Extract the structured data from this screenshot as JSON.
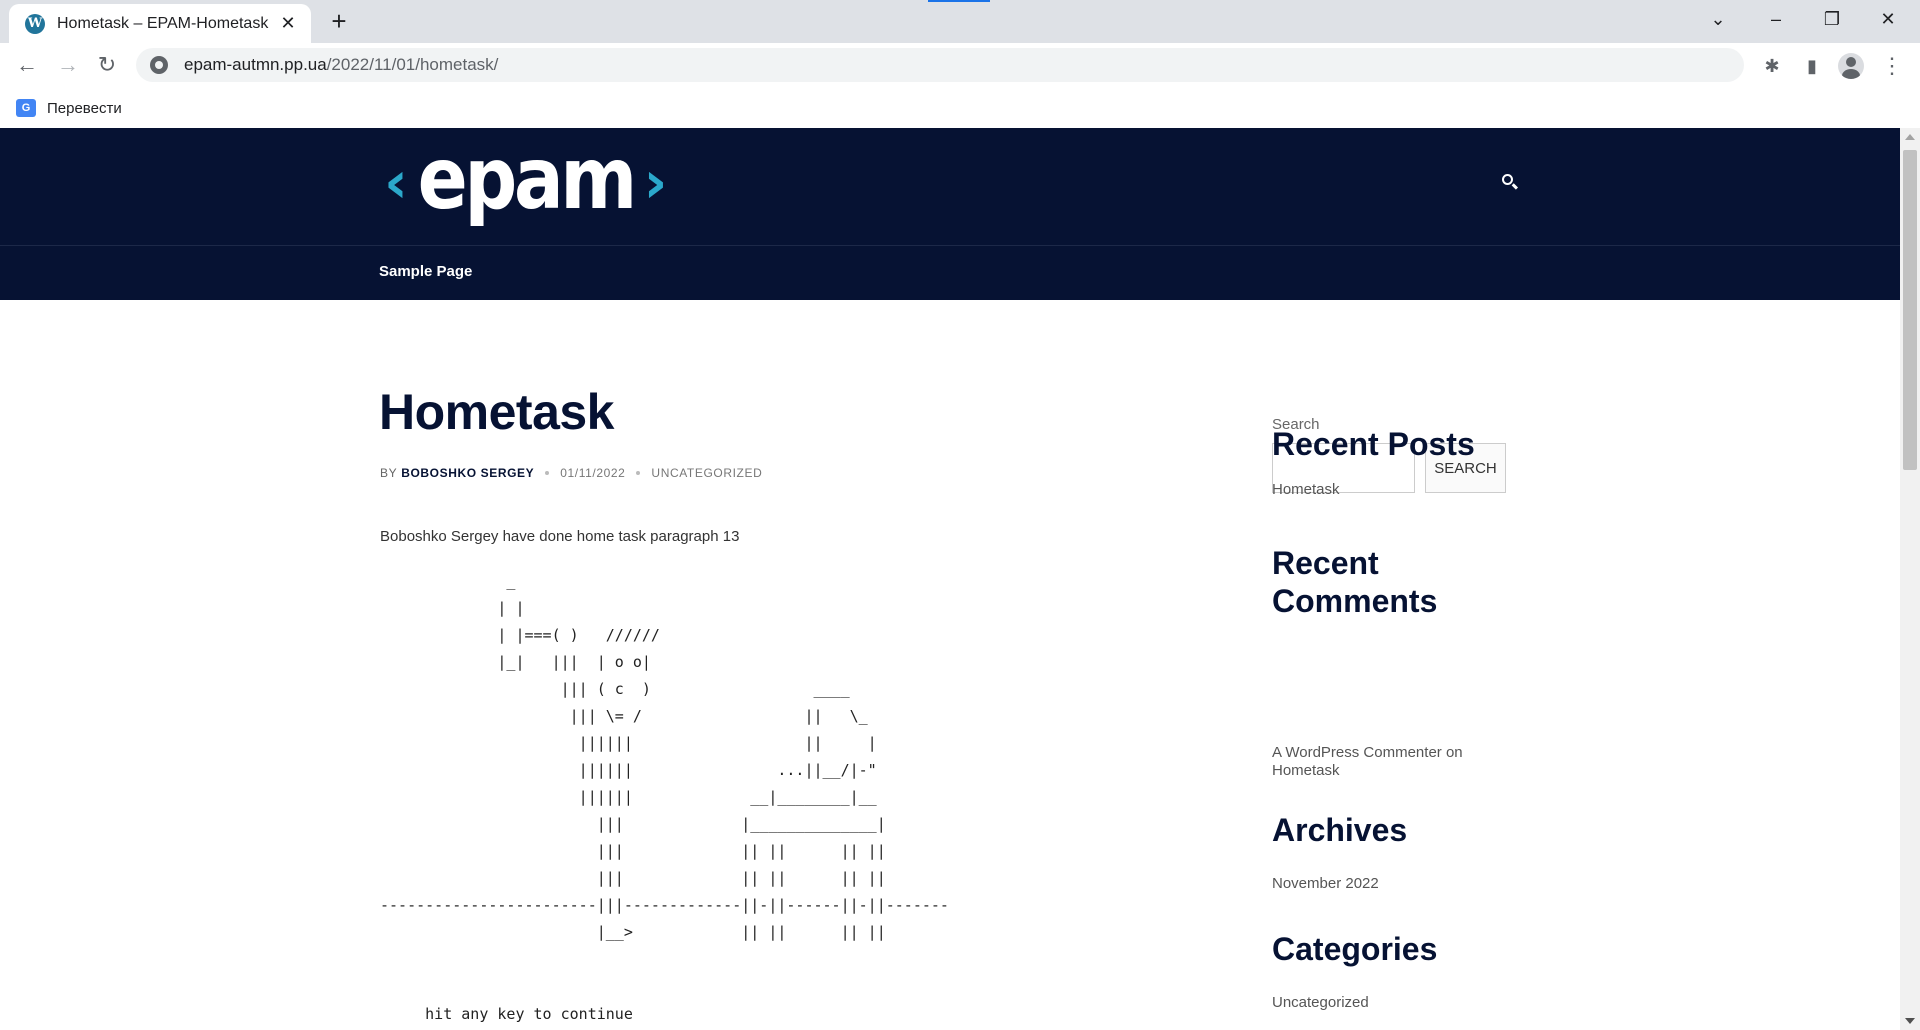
{
  "browser": {
    "tab_title": "Hometask – EPAM-Hometask",
    "new_tab_symbol": "+",
    "url_host": "epam-autmn.pp.ua",
    "url_path": "/2022/11/01/hometask/",
    "bookmark_label": "Перевести"
  },
  "site": {
    "logo_text": "epam",
    "nav_items": [
      "Sample Page"
    ]
  },
  "post": {
    "title": "Hometask",
    "by": "By",
    "author": "Boboshko Sergey",
    "date": "01/11/2022",
    "category": "Uncategorized",
    "paragraph": "Boboshko Sergey have done home task paragraph 13",
    "ascii_art": "              _\n             | |\n             | |===( )   //////\n             |_|   |||  | o o|\n                    ||| ( c  )                  ____\n                     ||| \\= /                  ||   \\_\n                      ||||||                   ||     |\n                      ||||||                ...||__/|-\"\n                      ||||||             __|________|__\n                        |||             |______________|\n                        |||             || ||      || ||\n                        |||             || ||      || ||\n------------------------|||-------------||-||------||-||-------\n                        |__>            || ||      || ||",
    "prompt": "     hit any key to continue"
  },
  "sidebar": {
    "search_label": "Search",
    "search_button": "Search",
    "recent_posts_title": "Recent Posts",
    "recent_posts": [
      "Hometask"
    ],
    "recent_comments_title": "Recent Comments",
    "recent_comment": "A WordPress Commenter on Hometask",
    "archives_title": "Archives",
    "archives": [
      "November 2022"
    ],
    "categories_title": "Categories",
    "categories": [
      "Uncategorized"
    ]
  },
  "colors": {
    "header_bg": "#061233",
    "logo_accent": "#2ba8cb",
    "title_color": "#061233"
  }
}
